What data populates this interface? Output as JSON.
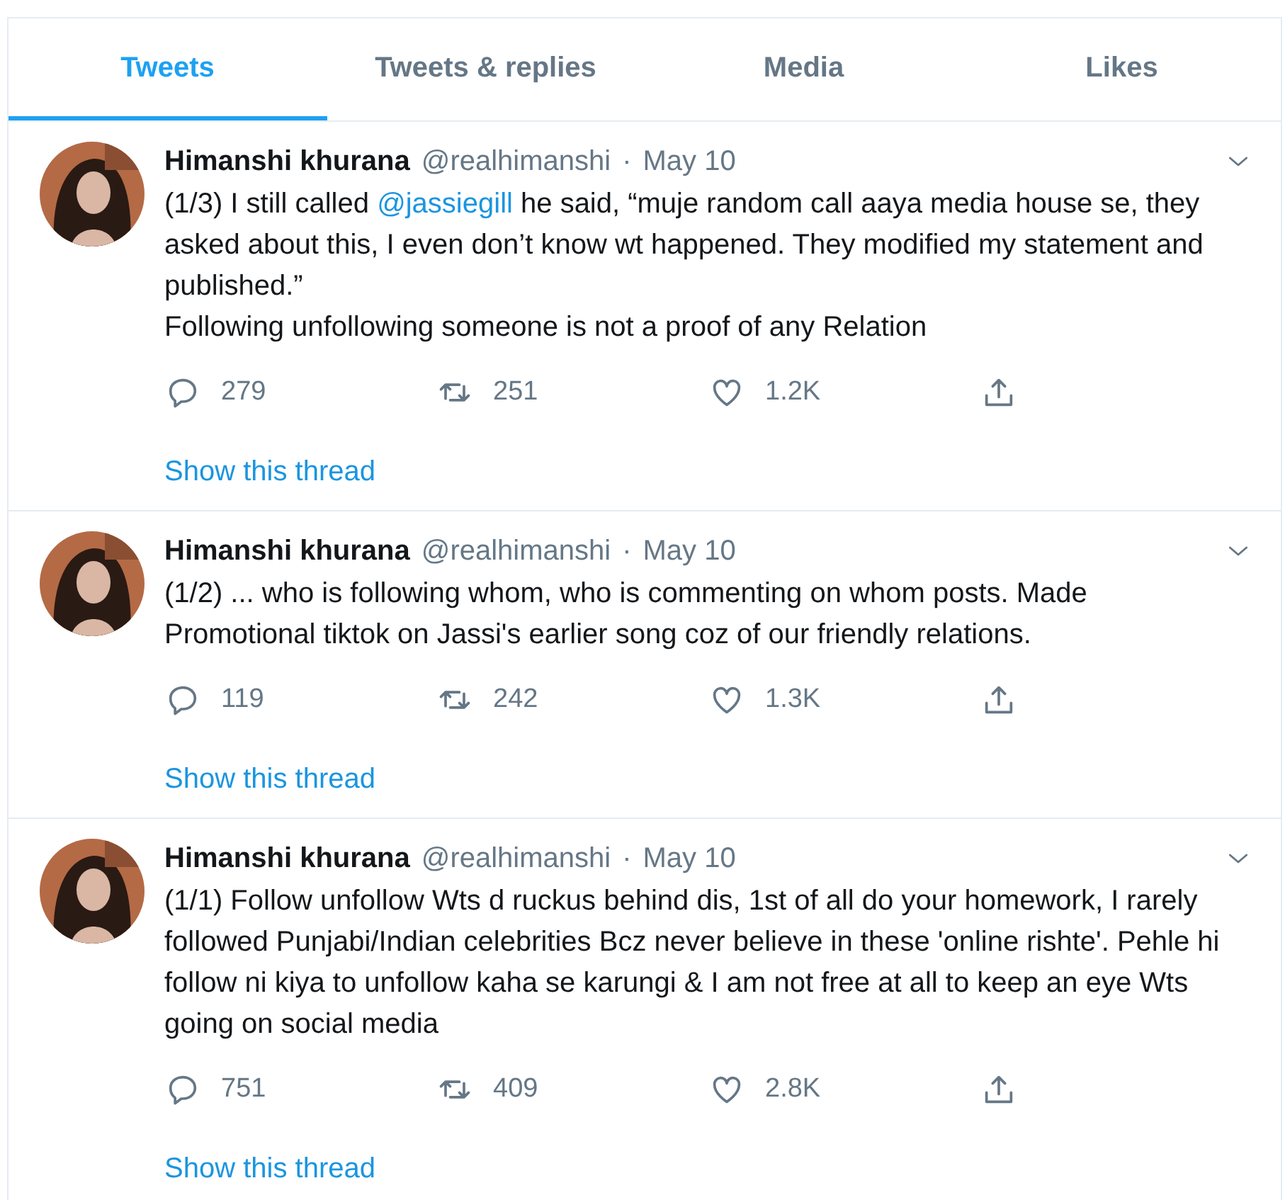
{
  "tabs": [
    {
      "label": "Tweets",
      "selected": true
    },
    {
      "label": "Tweets & replies",
      "selected": false
    },
    {
      "label": "Media",
      "selected": false
    },
    {
      "label": "Likes",
      "selected": false
    }
  ],
  "tweets": [
    {
      "name": "Himanshi khurana",
      "handle": "@realhimanshi",
      "separator": "·",
      "date": "May 10",
      "body": [
        {
          "kind": "text",
          "text": "(1/3) I still called "
        },
        {
          "kind": "mention",
          "text": "@jassiegill"
        },
        {
          "kind": "text",
          "text": " he said, “muje random call aaya media house se, they asked about this, I even don’t know wt happened. They modified my statement and published.”\nFollowing unfollowing someone is not a proof of any Relation"
        }
      ],
      "replies": "279",
      "retweets": "251",
      "likes": "1.2K",
      "thread_link": "Show this thread"
    },
    {
      "name": "Himanshi khurana",
      "handle": "@realhimanshi",
      "separator": "·",
      "date": "May 10",
      "body": [
        {
          "kind": "text",
          "text": "(1/2) ... who is following whom, who is commenting on whom posts. Made Promotional tiktok on Jassi's earlier song coz of our friendly relations."
        }
      ],
      "replies": "119",
      "retweets": "242",
      "likes": "1.3K",
      "thread_link": "Show this thread"
    },
    {
      "name": "Himanshi khurana",
      "handle": "@realhimanshi",
      "separator": "·",
      "date": "May 10",
      "body": [
        {
          "kind": "text",
          "text": "(1/1) Follow unfollow Wts d ruckus behind dis, 1st of all do your homework, I rarely followed Punjabi/Indian celebrities Bcz never believe in these 'online rishte'. Pehle hi follow ni kiya to unfollow kaha se karungi & I am not free at all to keep an eye Wts going on social media"
        }
      ],
      "replies": "751",
      "retweets": "409",
      "likes": "2.8K",
      "thread_link": "Show this thread"
    }
  ]
}
